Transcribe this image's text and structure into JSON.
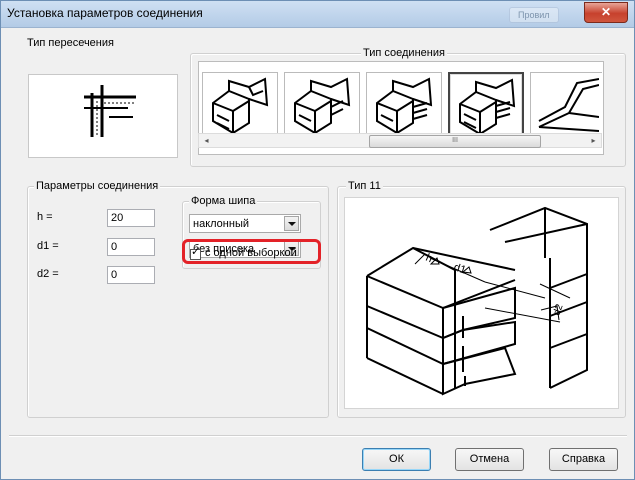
{
  "window": {
    "title": "Установка параметров соединения",
    "ghost_tab": "Провил",
    "close_glyph": "✕"
  },
  "intersection": {
    "legend": "Тип пересечения"
  },
  "connection_type": {
    "legend": "Тип соединения",
    "selected_index": 3,
    "scroll_center_glyph": "III",
    "scroll_left_glyph": "◂",
    "scroll_right_glyph": "▸"
  },
  "params": {
    "legend": "Параметры соединения",
    "h_label": "h =",
    "h_value": "20",
    "d1_label": "d1 =",
    "d1_value": "0",
    "d2_label": "d2 =",
    "d2_value": "0"
  },
  "tenon_shape": {
    "legend": "Форма шипа",
    "shape_value": "наклонный",
    "notch_value": "без присека"
  },
  "single_cut": {
    "checked": true,
    "check_glyph": "✓",
    "label": "с одной выборкой"
  },
  "preview": {
    "legend": "Тип 11"
  },
  "buttons": {
    "ok": "ОК",
    "cancel": "Отмена",
    "help": "Справка"
  },
  "colors": {
    "highlight_border": "#e32228",
    "title_bar": "#b3cbe6",
    "close_button": "#c7412d"
  }
}
